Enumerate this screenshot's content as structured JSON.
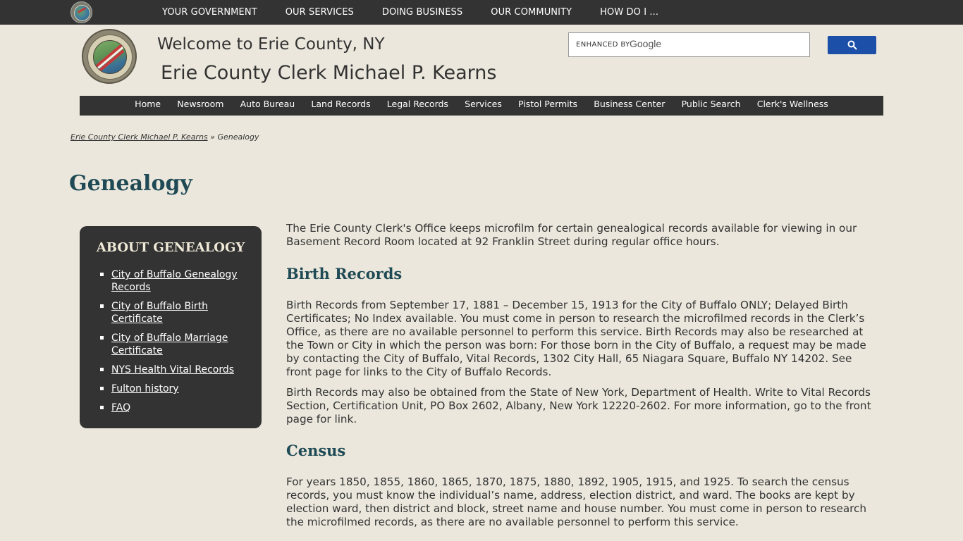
{
  "top_nav": {
    "items": [
      "YOUR GOVERNMENT",
      "OUR SERVICES",
      "DOING BUSINESS",
      "OUR COMMUNITY",
      "HOW DO I ..."
    ]
  },
  "header": {
    "welcome": "Welcome to Erie County, NY",
    "subtitle": "Erie County Clerk Michael P. Kearns"
  },
  "search": {
    "label": "ENHANCED BY",
    "brand": "Google",
    "button_icon": "search-icon"
  },
  "main_nav": {
    "items": [
      "Home",
      "Newsroom",
      "Auto Bureau",
      "Land Records",
      "Legal Records",
      "Services",
      "Pistol Permits",
      "Business Center",
      "Public Search",
      "Clerk's Wellness"
    ]
  },
  "breadcrumb": {
    "parent": "Erie County Clerk Michael P. Kearns",
    "separator": " » ",
    "current": "Genealogy"
  },
  "page": {
    "title": "Genealogy"
  },
  "sidebar": {
    "heading": "ABOUT GENEALOGY",
    "links": [
      "City of Buffalo Genealogy Records",
      "City of Buffalo Birth Certificate",
      "City of Buffalo Marriage Certificate",
      "NYS Health Vital Records",
      "Fulton history",
      "FAQ"
    ]
  },
  "content": {
    "intro": "The Erie County Clerk's Office keeps microfilm for certain genealogical records available for viewing in our Basement Record Room located at 92 Franklin Street during regular office hours.",
    "birth_heading": "Birth Records",
    "birth_p1": "Birth Records from September 17, 1881 – December 15, 1913 for the City of Buffalo ONLY; Delayed Birth Certificates; No Index available. You must come in person to research the microfilmed records in the Clerk’s Office, as there are no available personnel to perform this service. Birth Records may also be researched at the Town or City in which the person was born: For those born in the City of Buffalo, a request may be made by contacting the City of Buffalo, Vital Records, 1302 City Hall, 65 Niagara Square, Buffalo NY 14202.  See front page for links to the City of Buffalo Records.",
    "birth_p2": "Birth Records may also be obtained from the State of New York, Department of Health. Write to Vital Records Section, Certification Unit, PO Box 2602, Albany, New York 12220-2602.  For more information, go to the front page for link.",
    "census_heading": "Census",
    "census_p1": "For years 1850, 1855, 1860, 1865, 1870, 1875, 1880, 1892, 1905, 1915, and 1925. To search the census records, you must know the individual’s name, address, election district, and ward. The books are kept by election ward, then district and block, street name and house number. You must come in person to research the microfilmed records, as there are no available personnel to perform this service."
  }
}
